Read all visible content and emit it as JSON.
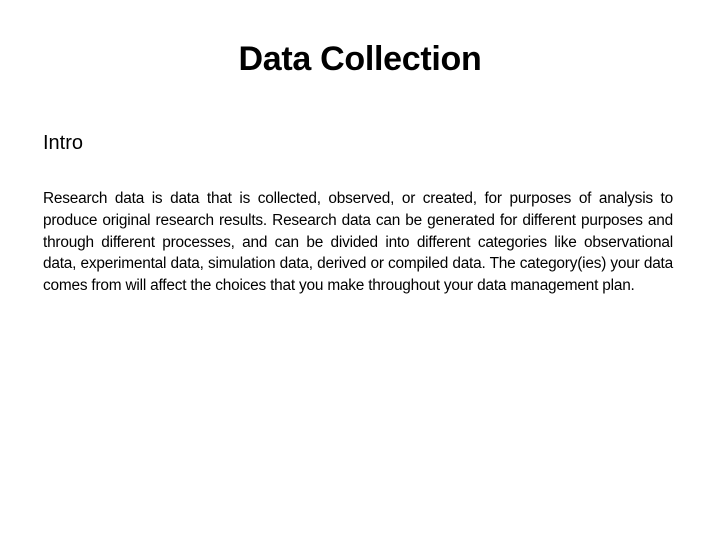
{
  "slide": {
    "title": "Data Collection",
    "section_heading": "Intro",
    "body": "Research data is data that is collected, observed, or created, for purposes of analysis to produce original research results. Research data can be generated for different purposes and through different processes, and can be divided into different categories like observational data, experimental data, simulation data, derived or compiled data. The category(ies) your data comes from will affect the choices that you make throughout your data management plan."
  }
}
